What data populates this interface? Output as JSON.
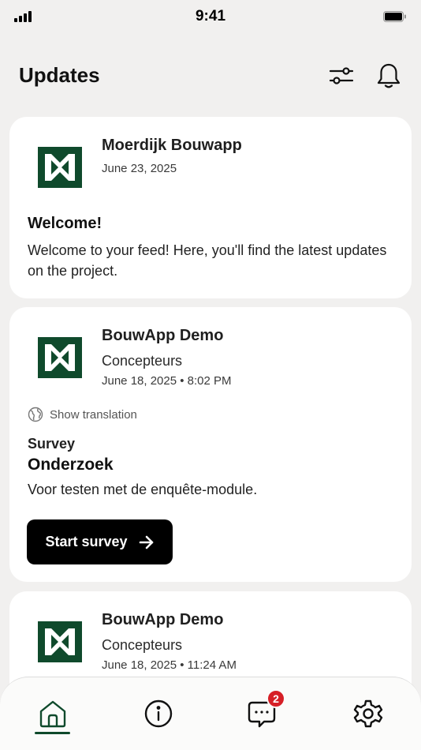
{
  "status_bar": {
    "time": "9:41"
  },
  "header": {
    "title": "Updates"
  },
  "feed": [
    {
      "author": "Moerdijk Bouwapp",
      "date": "June 23, 2025",
      "title": "Welcome!",
      "body": "Welcome to your feed! Here, you'll find the latest updates on the project."
    },
    {
      "author": "BouwApp Demo",
      "organization": "Concepteurs",
      "date": "June 18, 2025 • 8:02 PM",
      "translation_label": "Show translation",
      "type": "Survey",
      "title": "Onderzoek",
      "body": "Voor testen met de enquête-module.",
      "button_label": "Start survey"
    },
    {
      "author": "BouwApp Demo",
      "organization": "Concepteurs",
      "date": "June 18, 2025 • 11:24 AM"
    }
  ],
  "tab_bar": {
    "active": "home",
    "chat_badge": "2",
    "tabs": [
      "home-icon",
      "info-icon",
      "chat-icon",
      "settings-icon"
    ]
  },
  "colors": {
    "brand_green": "#0f4a2c",
    "badge_red": "#d61f26",
    "button_black": "#000000"
  }
}
